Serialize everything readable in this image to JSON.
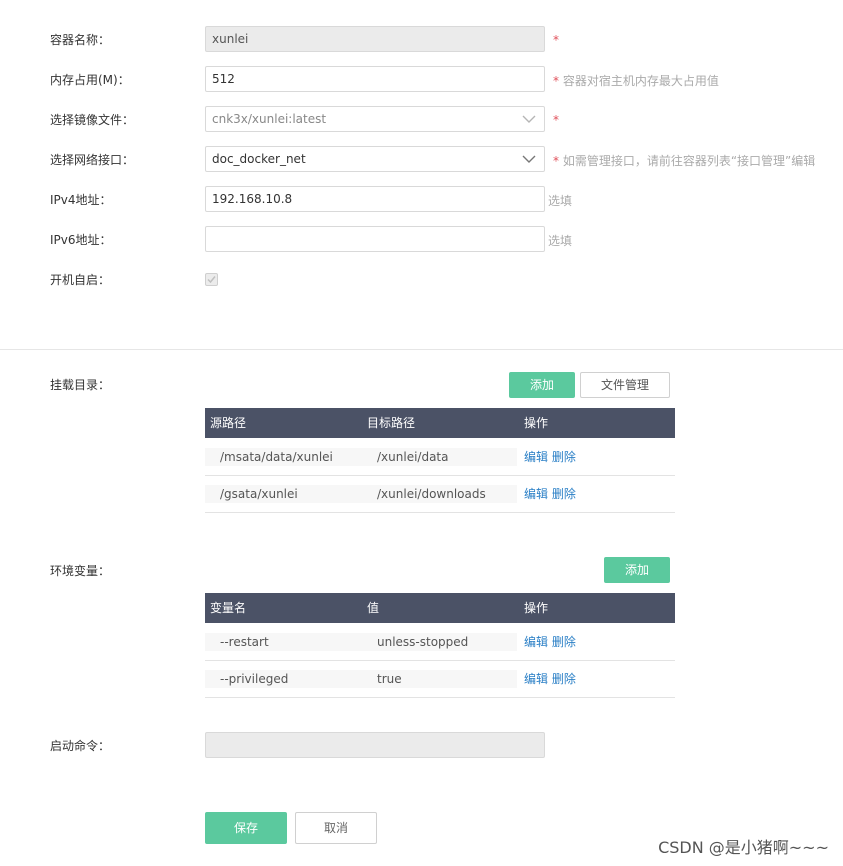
{
  "form": {
    "container_name": {
      "label": "容器名称：",
      "value": "xunlei",
      "required": "*"
    },
    "memory": {
      "label": "内存占用(M)：",
      "value": "512",
      "required": "*",
      "hint": "容器对宿主机内存最大占用值"
    },
    "image": {
      "label": "选择镜像文件：",
      "value": "cnk3x/xunlei:latest",
      "required": "*"
    },
    "network": {
      "label": "选择网络接口：",
      "value": "doc_docker_net",
      "required": "*",
      "hint": "如需管理接口，请前往容器列表“接口管理”编辑"
    },
    "ipv4": {
      "label": "IPv4地址：",
      "value": "192.168.10.8",
      "hint": "选填"
    },
    "ipv6": {
      "label": "IPv6地址：",
      "value": "",
      "hint": "选填"
    },
    "autostart": {
      "label": "开机自启：",
      "checked": true
    }
  },
  "mounts": {
    "label": "挂载目录：",
    "add_label": "添加",
    "file_mgmt_label": "文件管理",
    "columns": [
      "源路径",
      "目标路径",
      "操作"
    ],
    "rows": [
      {
        "src": "/msata/data/xunlei",
        "dst": "/xunlei/data",
        "edit": "编辑",
        "delete": "删除"
      },
      {
        "src": "/gsata/xunlei",
        "dst": "/xunlei/downloads",
        "edit": "编辑",
        "delete": "删除"
      }
    ]
  },
  "env": {
    "label": "环境变量：",
    "add_label": "添加",
    "columns": [
      "变量名",
      "值",
      "操作"
    ],
    "rows": [
      {
        "name": "--restart",
        "value": "unless-stopped",
        "edit": "编辑",
        "delete": "删除"
      },
      {
        "name": "--privileged",
        "value": "true",
        "edit": "编辑",
        "delete": "删除"
      }
    ]
  },
  "command": {
    "label": "启动命令：",
    "value": ""
  },
  "actions": {
    "save_label": "保存",
    "cancel_label": "取消"
  },
  "watermark": "CSDN @是小猪啊~~~",
  "colors": {
    "accent": "#5bc99e",
    "table_header": "#4b5266",
    "link": "#2a7fc6",
    "required": "#e0505a"
  }
}
